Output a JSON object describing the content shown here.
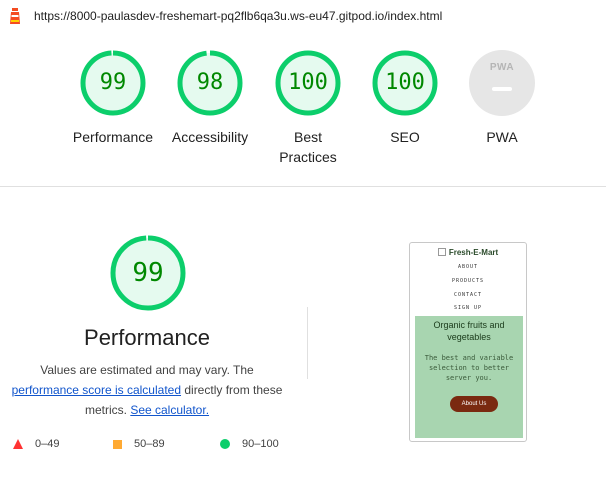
{
  "url": "https://8000-paulasdev-freshemart-pq2flb6qa3u.ws-eu47.gitpod.io/index.html",
  "colors": {
    "pass": "#0cce6b",
    "pass_text": "#008800",
    "pass_bg": "#e5faef",
    "average": "#ffaa33",
    "fail": "#ff3333",
    "link": "#1155cc"
  },
  "gauges": [
    {
      "score": "99",
      "label": "Performance"
    },
    {
      "score": "98",
      "label": "Accessibility"
    },
    {
      "score": "100",
      "label_line1": "Best",
      "label_line2": "Practices"
    },
    {
      "score": "100",
      "label": "SEO"
    },
    {
      "badge": "PWA",
      "label": "PWA"
    }
  ],
  "main": {
    "score": "99",
    "title": "Performance",
    "desc_line1": "Values are estimated and may vary. The",
    "desc_link": "performance score is calculated",
    "desc_mid": " directly from these",
    "desc_line3": "metrics.",
    "calc_link": "See calculator."
  },
  "legend": {
    "fail": "0–49",
    "average": "50–89",
    "pass": "90–100"
  },
  "preview": {
    "brand": "Fresh-E-Mart",
    "nav": [
      "ABOUT",
      "PRODUCTS",
      "CONTACT",
      "SIGN UP"
    ],
    "hero_title": "Organic fruits and vegetables",
    "hero_sub": "The best and variable selection to better server you.",
    "button": "About Us"
  }
}
